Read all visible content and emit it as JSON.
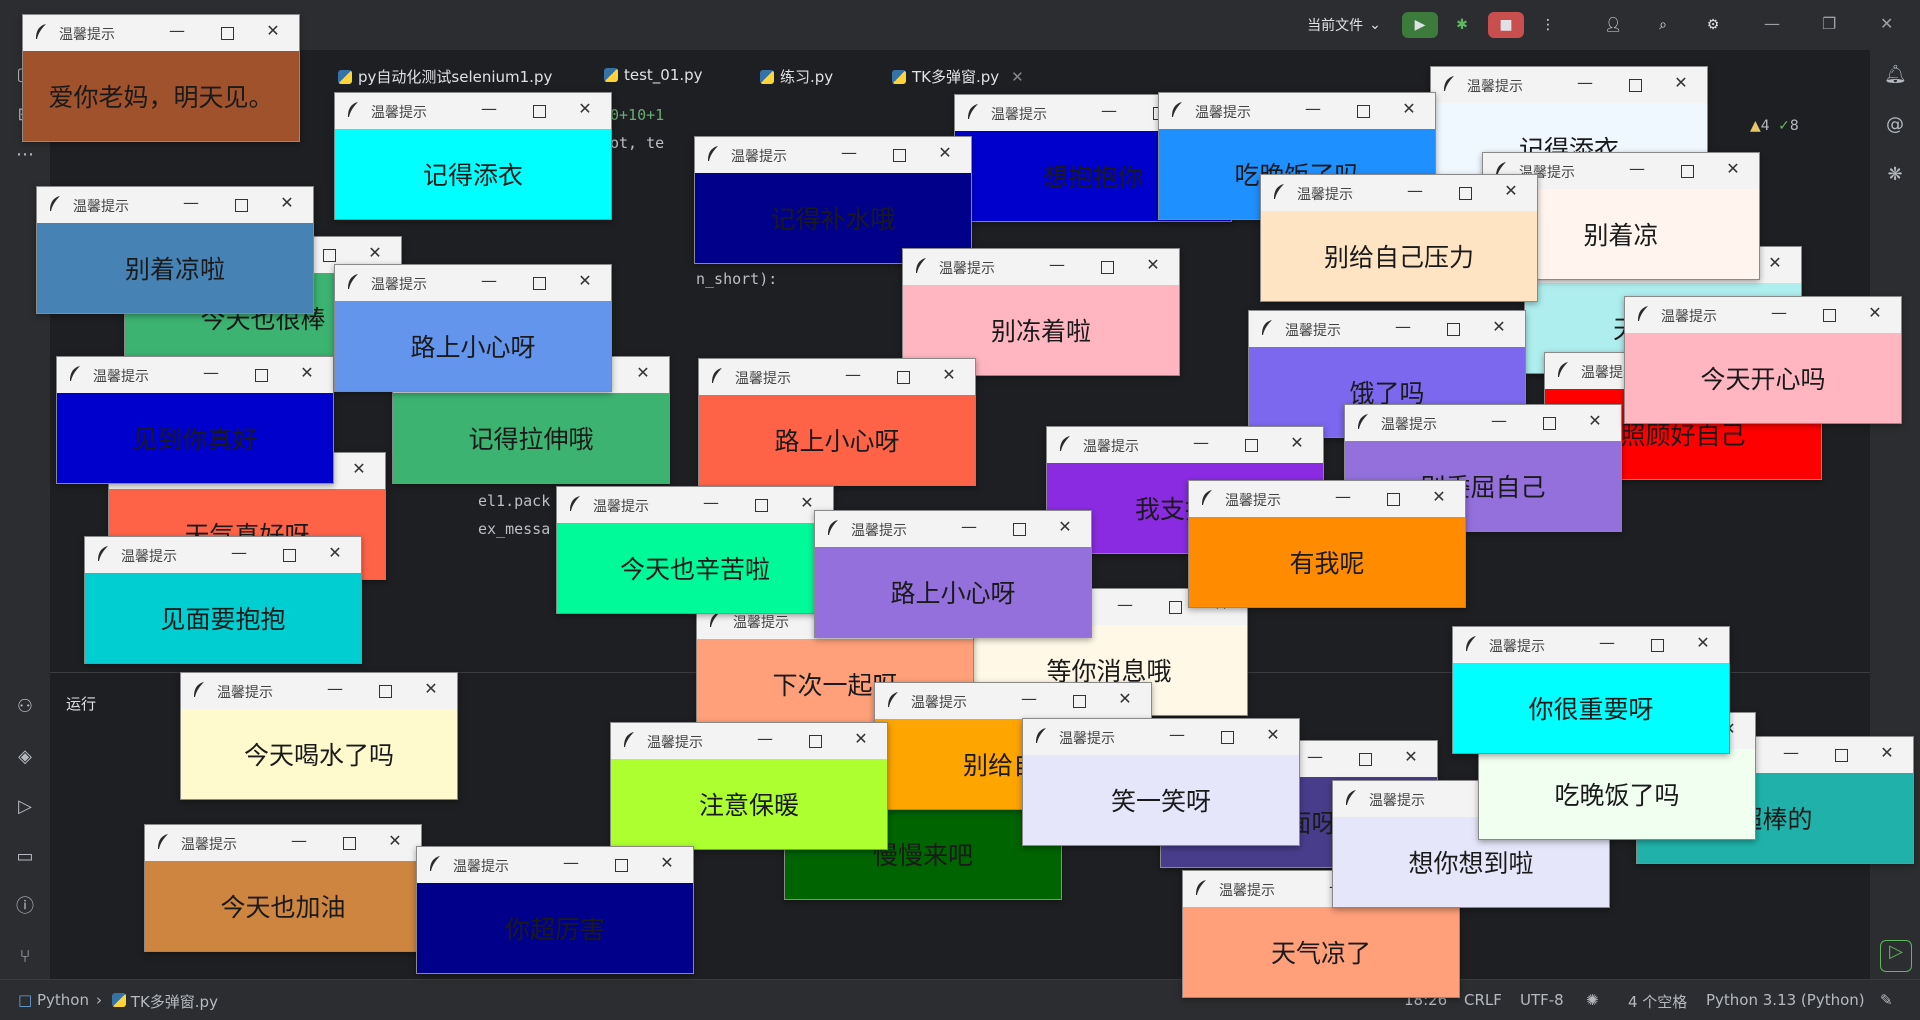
{
  "topbar": {
    "current_file": "当前文件",
    "current_file_chevron": "chevron-down-icon"
  },
  "tabs": [
    {
      "label": "py自动化测试selenium1.py"
    },
    {
      "label": "test_01.py"
    },
    {
      "label": "练习.py"
    },
    {
      "label": "TK多弹窗.py"
    }
  ],
  "run_panel": {
    "label": "运行"
  },
  "code_fragments": [
    "0+10+1",
    "ot, te",
    "n_short):",
    "el1.pack",
    "ex_messa"
  ],
  "inspection": {
    "warnings": "4",
    "ok": "8"
  },
  "statusbar": {
    "project": "Python",
    "file": "TK多弹窗.py",
    "position": "18:26",
    "line_sep": "CRLF",
    "encoding": "UTF-8",
    "indent": "4 个空格",
    "interpreter": "Python 3.13 (Python)"
  },
  "popup_title": "温馨提示",
  "popups": [
    {
      "msg": "爱你老妈，明天见。",
      "bg": "#a0522d"
    },
    {
      "msg": "记得添衣",
      "bg": "#00ffff"
    },
    {
      "msg": "别着凉啦",
      "bg": "#4682b4"
    },
    {
      "msg": "路上小心呀",
      "bg": "#6495ed"
    },
    {
      "msg": "见到你真好",
      "bg": "#0000cd"
    },
    {
      "msg": "见面要抱抱",
      "bg": "#00ced1"
    },
    {
      "msg": "今天喝水了吗",
      "bg": "#fffacd"
    },
    {
      "msg": "今天也加油",
      "bg": "#cd853f"
    },
    {
      "msg": "记得补水哦",
      "bg": "#00008b"
    },
    {
      "msg": "别冻着啦",
      "bg": "#ffb6c1"
    },
    {
      "msg": "路上小心呀",
      "bg": "#ff6347"
    },
    {
      "msg": "今天也辛苦啦",
      "bg": "#00fa9a"
    },
    {
      "msg": "路上小心呀",
      "bg": "#9370db"
    },
    {
      "msg": "有我呢",
      "bg": "#ff8c00"
    },
    {
      "msg": "别给自己压力",
      "bg": "#ffe4c4"
    },
    {
      "msg": "别着凉",
      "bg": "#fff5ee"
    },
    {
      "msg": "今天开心吗",
      "bg": "#ffb6c1"
    },
    {
      "msg": "你很重要呀",
      "bg": "#00ffff"
    },
    {
      "msg": "吃晚饭了吗",
      "bg": "#f0fff0"
    },
    {
      "msg": "注意保暖",
      "bg": "#adff2f"
    },
    {
      "msg": "笑一笑呀",
      "bg": "#e6e6fa"
    },
    {
      "msg": "别给自己",
      "bg": "#ffa500"
    },
    {
      "msg": "下次一起呀",
      "bg": "#ffa07a"
    },
    {
      "msg": "等你消息哦",
      "bg": "#fff8e7"
    },
    {
      "msg": "想你想到啦",
      "bg": "#e6e6fa"
    },
    {
      "msg": "天气凉了",
      "bg": "#ffa07a"
    },
    {
      "msg": "吃晚饭了吗",
      "bg": "#1e90ff"
    },
    {
      "msg": "想抱抱你",
      "bg": "#0000cd"
    },
    {
      "msg": "记得添衣",
      "bg": "#f0f8ff"
    },
    {
      "msg": "别委屈自己",
      "bg": "#9370db"
    },
    {
      "msg": "我支持你",
      "bg": "#8a2be2"
    },
    {
      "msg": "饿了吗",
      "bg": "#7b68ee"
    },
    {
      "msg": "今天也很棒",
      "bg": "#3cb371"
    },
    {
      "msg": "天气真好呀",
      "bg": "#ff6347"
    },
    {
      "msg": "记得拉伸哦",
      "bg": "#3cb371"
    },
    {
      "msg": "你超厉害",
      "bg": "#00008b"
    },
    {
      "msg": "超棒的",
      "bg": "#20b2aa"
    },
    {
      "msg": "照顾好自己",
      "bg": "#ff0000"
    },
    {
      "msg": "天气真好",
      "bg": "#afeeee"
    },
    {
      "msg": "慢慢来吧",
      "bg": "#006400"
    },
    {
      "msg": "见面呀",
      "bg": "#483d8b"
    }
  ]
}
